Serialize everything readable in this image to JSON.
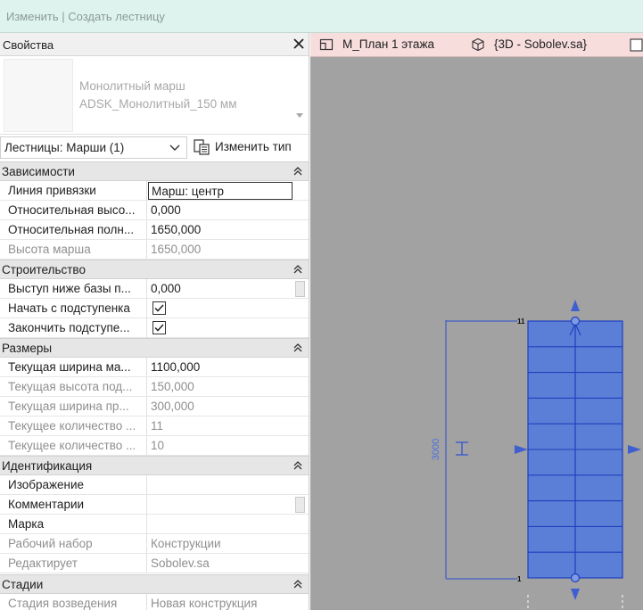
{
  "context_bar": {
    "title": "Изменить | Создать лестницу"
  },
  "properties": {
    "title": "Свойства",
    "type_selector": {
      "family": "Монолитный марш",
      "type": "ADSK_Монолитный_150 мм"
    },
    "filter": "Лестницы: Марши (1)",
    "edit_type_label": "Изменить тип",
    "sections": {
      "constraints": {
        "title": "Зависимости",
        "rows": [
          {
            "name": "Линия привязки",
            "value": "Марш: центр"
          },
          {
            "name": "Относительная высо...",
            "value": "0,000"
          },
          {
            "name": "Относительная полн...",
            "value": "1650,000"
          },
          {
            "name": "Высота марша",
            "value": "1650,000"
          }
        ]
      },
      "construction": {
        "title": "Строительство",
        "rows": [
          {
            "name": "Выступ ниже базы п...",
            "value": "0,000"
          },
          {
            "name": "Начать с подступенка",
            "checked": true
          },
          {
            "name": "Закончить подступе...",
            "checked": true
          }
        ]
      },
      "dimensions": {
        "title": "Размеры",
        "rows": [
          {
            "name": "Текущая ширина ма...",
            "value": "1100,000"
          },
          {
            "name": "Текущая высота под...",
            "value": "150,000"
          },
          {
            "name": "Текущая ширина пр...",
            "value": "300,000"
          },
          {
            "name": "Текущее количество ...",
            "value": "11"
          },
          {
            "name": "Текущее количество ...",
            "value": "10"
          }
        ]
      },
      "identity": {
        "title": "Идентификация",
        "rows": [
          {
            "name": "Изображение",
            "value": ""
          },
          {
            "name": "Комментарии",
            "value": ""
          },
          {
            "name": "Марка",
            "value": ""
          },
          {
            "name": "Рабочий набор",
            "value": "Конструкции"
          },
          {
            "name": "Редактирует",
            "value": "Sobolev.sa"
          }
        ]
      },
      "phasing": {
        "title": "Стадии",
        "rows": [
          {
            "name": "Стадия возведения",
            "value": "Новая конструкция"
          }
        ]
      }
    }
  },
  "tabs": [
    {
      "label": "М_План 1 этажа",
      "icon": "floor-plan-icon"
    },
    {
      "label": "{3D - Sobolev.sa}",
      "icon": "3d-view-icon"
    }
  ],
  "canvas": {
    "background": "#a2a2a2",
    "stair_fill": "#5b7fd6",
    "stair_line": "#1f3fbf",
    "dim_line": "#2a4fd0",
    "riser_count": 11,
    "dimension_text": "3000",
    "top_label": "11",
    "bottom_label": "1"
  }
}
